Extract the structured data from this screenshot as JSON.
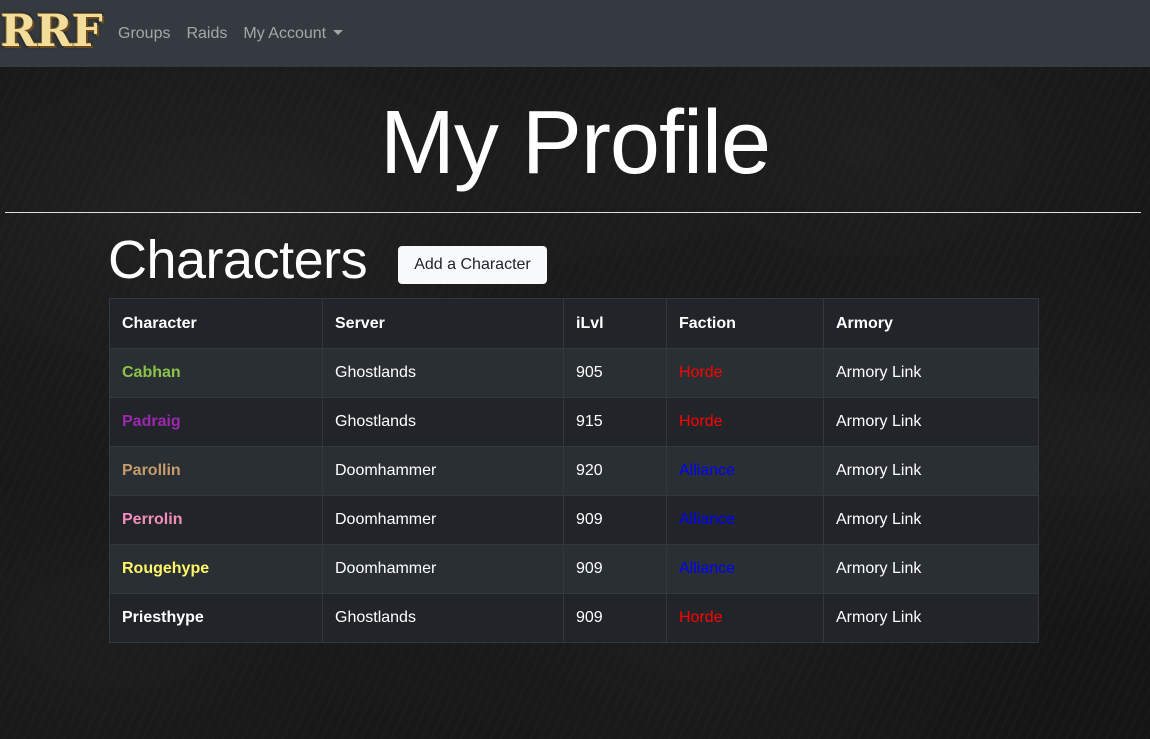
{
  "nav": {
    "brand": "RRF",
    "links": [
      "Groups",
      "Raids",
      "My Account"
    ]
  },
  "page": {
    "title": "My Profile",
    "section_title": "Characters",
    "add_button": "Add a Character"
  },
  "table": {
    "headers": [
      "Character",
      "Server",
      "iLvl",
      "Faction",
      "Armory"
    ],
    "rows": [
      {
        "name": "Cabhan",
        "name_color": "#8bc34a",
        "server": "Ghostlands",
        "ilvl": "905",
        "faction": "Horde",
        "faction_color": "#ff0000",
        "armory": "Armory Link"
      },
      {
        "name": "Padraig",
        "name_color": "#9c27b0",
        "server": "Ghostlands",
        "ilvl": "915",
        "faction": "Horde",
        "faction_color": "#ff0000",
        "armory": "Armory Link"
      },
      {
        "name": "Parollin",
        "name_color": "#c69b6d",
        "server": "Doomhammer",
        "ilvl": "920",
        "faction": "Alliance",
        "faction_color": "#0000ff",
        "armory": "Armory Link"
      },
      {
        "name": "Perrolin",
        "name_color": "#f58cba",
        "server": "Doomhammer",
        "ilvl": "909",
        "faction": "Alliance",
        "faction_color": "#0000ff",
        "armory": "Armory Link"
      },
      {
        "name": "Rougehype",
        "name_color": "#fff569",
        "server": "Doomhammer",
        "ilvl": "909",
        "faction": "Alliance",
        "faction_color": "#0000ff",
        "armory": "Armory Link"
      },
      {
        "name": "Priesthype",
        "name_color": "#ffffff",
        "server": "Ghostlands",
        "ilvl": "909",
        "faction": "Horde",
        "faction_color": "#ff0000",
        "armory": "Armory Link"
      }
    ]
  }
}
